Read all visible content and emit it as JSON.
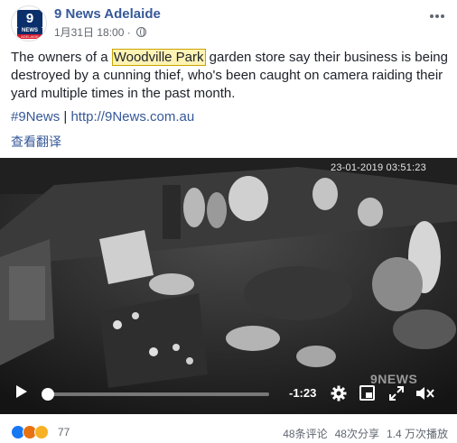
{
  "post": {
    "page_name": "9 News Adelaide",
    "timestamp": "1月31日 18:00",
    "text_before": "The owners of a ",
    "text_highlight": "Woodville Park",
    "text_after": " garden store say their business is being destroyed by a cunning thief, who's been caught on camera raiding their yard multiple times in the past month.",
    "hashtag": "#9News",
    "separator": "|",
    "link": "http://9News.com.au",
    "translate_label": "查看翻译"
  },
  "avatar": {
    "line1": "9",
    "line2": "NEWS",
    "line3": "ADELAIDE"
  },
  "video": {
    "timestamp_overlay": "23-01-2019 03:51:23",
    "watermark": "9NEWS",
    "time_remaining": "-1:23",
    "progress_fraction": 0.02
  },
  "footer": {
    "reaction_count": "77",
    "comments": "48条评论",
    "shares": "48次分享",
    "plays": "1.4 万次播放"
  },
  "colors": {
    "link": "#365899",
    "text": "#1d2129",
    "meta": "#606770"
  },
  "icons": [
    "globe-icon",
    "more-icon",
    "play-icon",
    "settings-icon",
    "pip-icon",
    "fullscreen-icon",
    "volume-icon",
    "like-reaction-icon",
    "angry-reaction-icon",
    "wow-reaction-icon"
  ]
}
